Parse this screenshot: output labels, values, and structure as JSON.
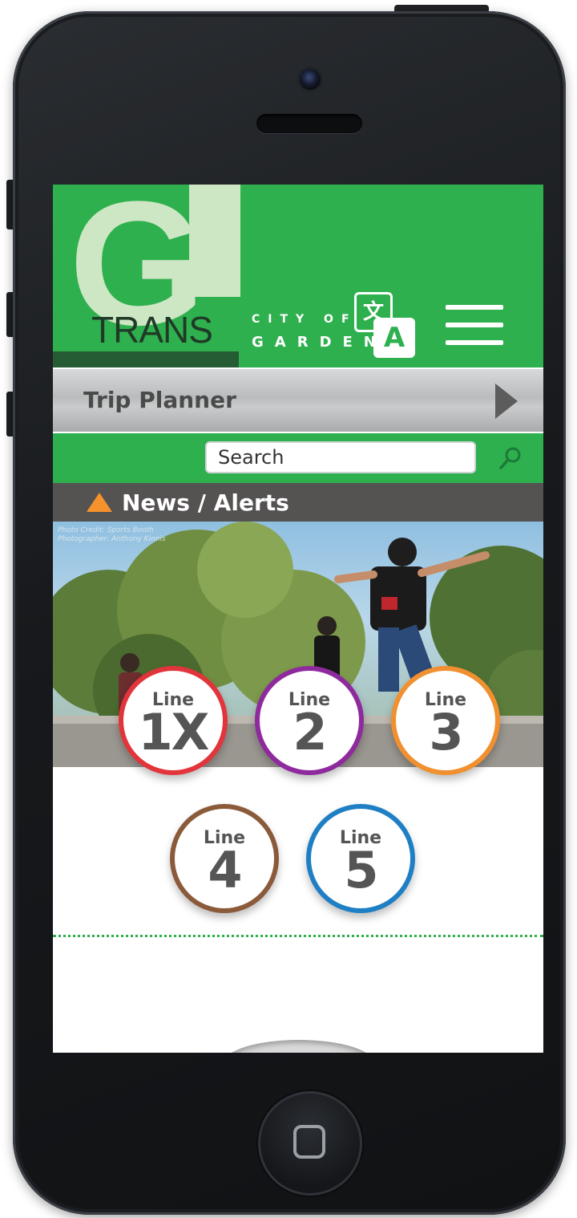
{
  "header": {
    "logo_letter": "G",
    "logo_word": "TRANS",
    "city_of": "CITY OF",
    "city_name": "GARDENA",
    "translate_glyph_back": "文",
    "translate_glyph_front": "A"
  },
  "trip_planner": {
    "label": "Trip Planner"
  },
  "search": {
    "placeholder": "Search"
  },
  "news": {
    "label": "News / Alerts"
  },
  "hero": {
    "credit_line_1": "Photo Credit: Sports Booth",
    "credit_line_2": "Photographer: Anthony Kinnis"
  },
  "lines": [
    {
      "word": "Line",
      "number": "1X",
      "color": "#e2343b"
    },
    {
      "word": "Line",
      "number": "2",
      "color": "#8e2a9e"
    },
    {
      "word": "Line",
      "number": "3",
      "color": "#f09030"
    },
    {
      "word": "Line",
      "number": "4",
      "color": "#8a5a3a"
    },
    {
      "word": "Line",
      "number": "5",
      "color": "#1f7fc4"
    }
  ],
  "colors": {
    "brand_green": "#2fb04f",
    "dark_green": "#255c33",
    "news_bar": "#555252",
    "alert_orange": "#f5922b"
  }
}
